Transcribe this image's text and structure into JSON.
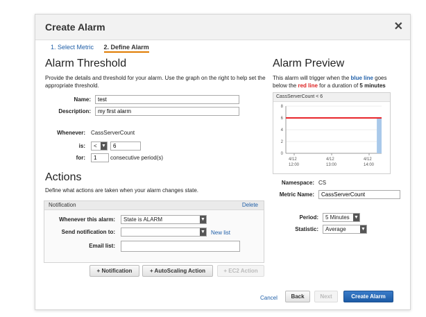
{
  "dialog": {
    "title": "Create Alarm",
    "close_glyph": "✕",
    "steps": [
      "1. Select Metric",
      "2. Define Alarm"
    ]
  },
  "threshold": {
    "heading": "Alarm Threshold",
    "description": "Provide the details and threshold for your alarm. Use the graph on the right to help set the appropriate threshold.",
    "name_label": "Name:",
    "name_value": "test",
    "description_label": "Description:",
    "description_value": "my first alarm",
    "whenever_label": "Whenever:",
    "whenever_value": "CassServerCount",
    "is_label": "is:",
    "operator_value": "<",
    "threshold_value": "6",
    "for_label": "for:",
    "periods_value": "1",
    "periods_suffix": "consecutive period(s)"
  },
  "actions": {
    "heading": "Actions",
    "description": "Define what actions are taken when your alarm changes state.",
    "notification_title": "Notification",
    "delete_label": "Delete",
    "whenever_alarm_label": "Whenever this alarm:",
    "whenever_alarm_value": "State is ALARM",
    "send_to_label": "Send notification to:",
    "send_to_value": "",
    "new_list_label": "New list",
    "email_list_label": "Email list:",
    "email_list_value": "",
    "buttons": {
      "notification": "+ Notification",
      "autoscaling": "+ AutoScaling Action",
      "ec2": "+ EC2 Action"
    }
  },
  "preview": {
    "heading": "Alarm Preview",
    "text_before": "This alarm will trigger when the ",
    "blue_line": "blue line",
    "text_mid": " goes below the ",
    "red_line": "red line",
    "text_after": " for a duration of ",
    "duration": "5 minutes",
    "namespace_label": "Namespace:",
    "namespace_value": "CS",
    "metric_name_label": "Metric Name:",
    "metric_name_value": "CassServerCount",
    "period_label": "Period:",
    "period_value": "5 Minutes",
    "statistic_label": "Statistic:",
    "statistic_value": "Average"
  },
  "chart_data": {
    "type": "line",
    "title": "CassServerCount < 6",
    "threshold": 6,
    "threshold_color": "#e8252a",
    "series_color": "#a9c9ea",
    "ylim": [
      0,
      8
    ],
    "yticks": [
      "8",
      "6",
      "4",
      "2",
      "0"
    ],
    "xticks": [
      {
        "line1": "4/12",
        "line2": "12:00"
      },
      {
        "line1": "4/12",
        "line2": "13:00"
      },
      {
        "line1": "4/12",
        "line2": "14:00"
      }
    ],
    "series": [
      {
        "x_fraction_start": 0.95,
        "x_fraction_end": 1.0,
        "value": 6
      }
    ]
  },
  "footer": {
    "cancel": "Cancel",
    "back": "Back",
    "next": "Next",
    "create": "Create Alarm"
  }
}
